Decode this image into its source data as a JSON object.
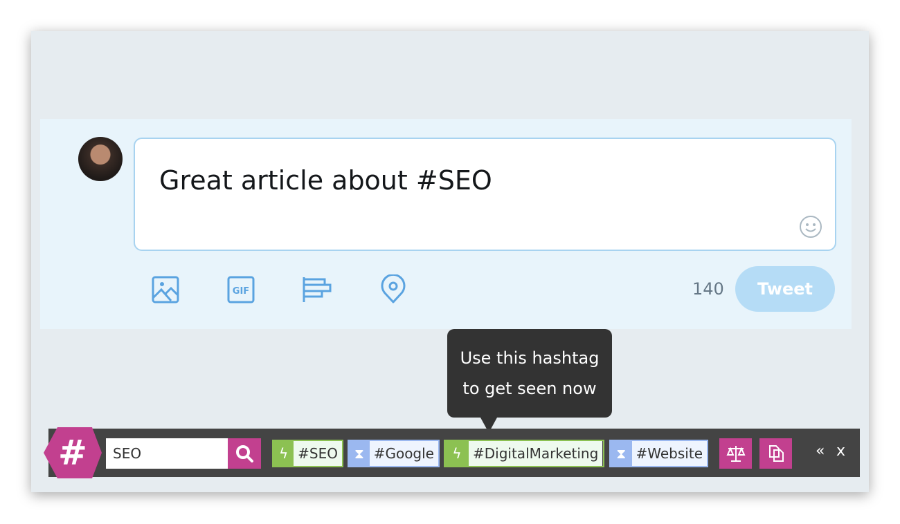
{
  "compose": {
    "text": "Great article about #SEO",
    "char_count": "140",
    "tweet_label": "Tweet",
    "icons": [
      "image-icon",
      "gif-icon",
      "poll-icon",
      "location-icon",
      "emoji-icon"
    ]
  },
  "tooltip": {
    "line1": "Use this hashtag",
    "line2": "to get seen now"
  },
  "toolbar": {
    "search_value": "SEO",
    "tags": [
      {
        "label": "#SEO",
        "type": "hot",
        "icon": "lightning-icon"
      },
      {
        "label": "#Google",
        "type": "long-life",
        "icon": "hourglass-icon"
      },
      {
        "label": "#DigitalMarketing",
        "type": "hot",
        "icon": "lightning-icon"
      },
      {
        "label": "#Website",
        "type": "long-life",
        "icon": "hourglass-icon"
      }
    ],
    "collapse_label": "«",
    "close_label": "x"
  },
  "colors": {
    "brand": "#c2408f",
    "hot": "#8cc152",
    "long_life": "#9bb8f0",
    "twitter_blue": "#5aa3e0"
  }
}
